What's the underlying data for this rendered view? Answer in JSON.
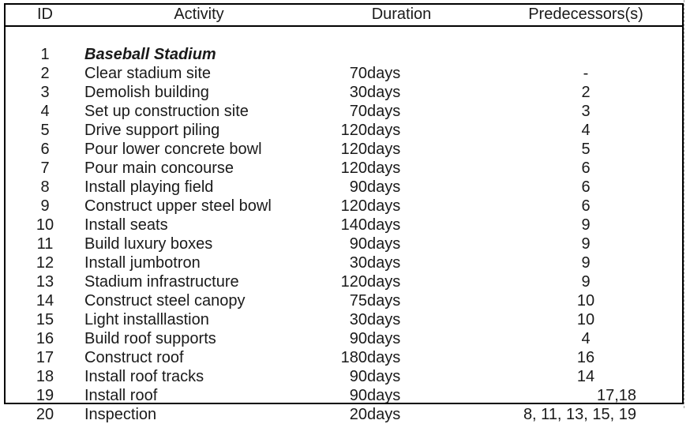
{
  "table": {
    "name": "project-activity-schedule",
    "headers": {
      "id": "ID",
      "activity": "Activity",
      "duration": "Duration",
      "predecessors": "Predecessors(s)"
    },
    "rows": [
      {
        "id": "1",
        "activity": "Baseball Stadium",
        "duration": "",
        "unit": "",
        "predecessors": "",
        "is_title": true,
        "pred_align": "center"
      },
      {
        "id": "2",
        "activity": "Clear stadium site",
        "duration": "70",
        "unit": "days",
        "predecessors": "-",
        "is_title": false,
        "pred_align": "center"
      },
      {
        "id": "3",
        "activity": "Demolish building",
        "duration": "30",
        "unit": "days",
        "predecessors": "2",
        "is_title": false,
        "pred_align": "center"
      },
      {
        "id": "4",
        "activity": "Set up construction site",
        "duration": "70",
        "unit": "days",
        "predecessors": "3",
        "is_title": false,
        "pred_align": "center"
      },
      {
        "id": "5",
        "activity": "Drive support piling",
        "duration": "120",
        "unit": "days",
        "predecessors": "4",
        "is_title": false,
        "pred_align": "center"
      },
      {
        "id": "6",
        "activity": "Pour lower concrete bowl",
        "duration": "120",
        "unit": "days",
        "predecessors": "5",
        "is_title": false,
        "pred_align": "center"
      },
      {
        "id": "7",
        "activity": "Pour main concourse",
        "duration": "120",
        "unit": "days",
        "predecessors": "6",
        "is_title": false,
        "pred_align": "center"
      },
      {
        "id": "8",
        "activity": "Install playing field",
        "duration": "90",
        "unit": "days",
        "predecessors": "6",
        "is_title": false,
        "pred_align": "center"
      },
      {
        "id": "9",
        "activity": "Construct upper steel bowl",
        "duration": "120",
        "unit": "days",
        "predecessors": "6",
        "is_title": false,
        "pred_align": "center"
      },
      {
        "id": "10",
        "activity": "Install seats",
        "duration": "140",
        "unit": "days",
        "predecessors": "9",
        "is_title": false,
        "pred_align": "center"
      },
      {
        "id": "11",
        "activity": "Build luxury boxes",
        "duration": "90",
        "unit": "days",
        "predecessors": "9",
        "is_title": false,
        "pred_align": "center"
      },
      {
        "id": "12",
        "activity": "Install jumbotron",
        "duration": "30",
        "unit": "days",
        "predecessors": "9",
        "is_title": false,
        "pred_align": "center"
      },
      {
        "id": "13",
        "activity": "Stadium infrastructure",
        "duration": "120",
        "unit": "days",
        "predecessors": "9",
        "is_title": false,
        "pred_align": "center"
      },
      {
        "id": "14",
        "activity": "Construct steel canopy",
        "duration": "75",
        "unit": "days",
        "predecessors": "10",
        "is_title": false,
        "pred_align": "center"
      },
      {
        "id": "15",
        "activity": "Light installlastion",
        "duration": "30",
        "unit": "days",
        "predecessors": "10",
        "is_title": false,
        "pred_align": "center"
      },
      {
        "id": "16",
        "activity": "Build roof supports",
        "duration": "90",
        "unit": "days",
        "predecessors": "4",
        "is_title": false,
        "pred_align": "center"
      },
      {
        "id": "17",
        "activity": "Construct roof",
        "duration": "180",
        "unit": "days",
        "predecessors": "16",
        "is_title": false,
        "pred_align": "center"
      },
      {
        "id": "18",
        "activity": "Install roof tracks",
        "duration": "90",
        "unit": "days",
        "predecessors": "14",
        "is_title": false,
        "pred_align": "center"
      },
      {
        "id": "19",
        "activity": "Install roof",
        "duration": "90",
        "unit": "days",
        "predecessors": "17,18",
        "is_title": false,
        "pred_align": "right"
      },
      {
        "id": "20",
        "activity": "Inspection",
        "duration": "20",
        "unit": "days",
        "predecessors": "8, 11, 13, 15, 19",
        "is_title": false,
        "pred_align": "right"
      }
    ]
  },
  "colors": {
    "border": "#000000",
    "text": "#1a1a1a",
    "background": "#ffffff",
    "margin_guide": "#9a9a9a"
  }
}
